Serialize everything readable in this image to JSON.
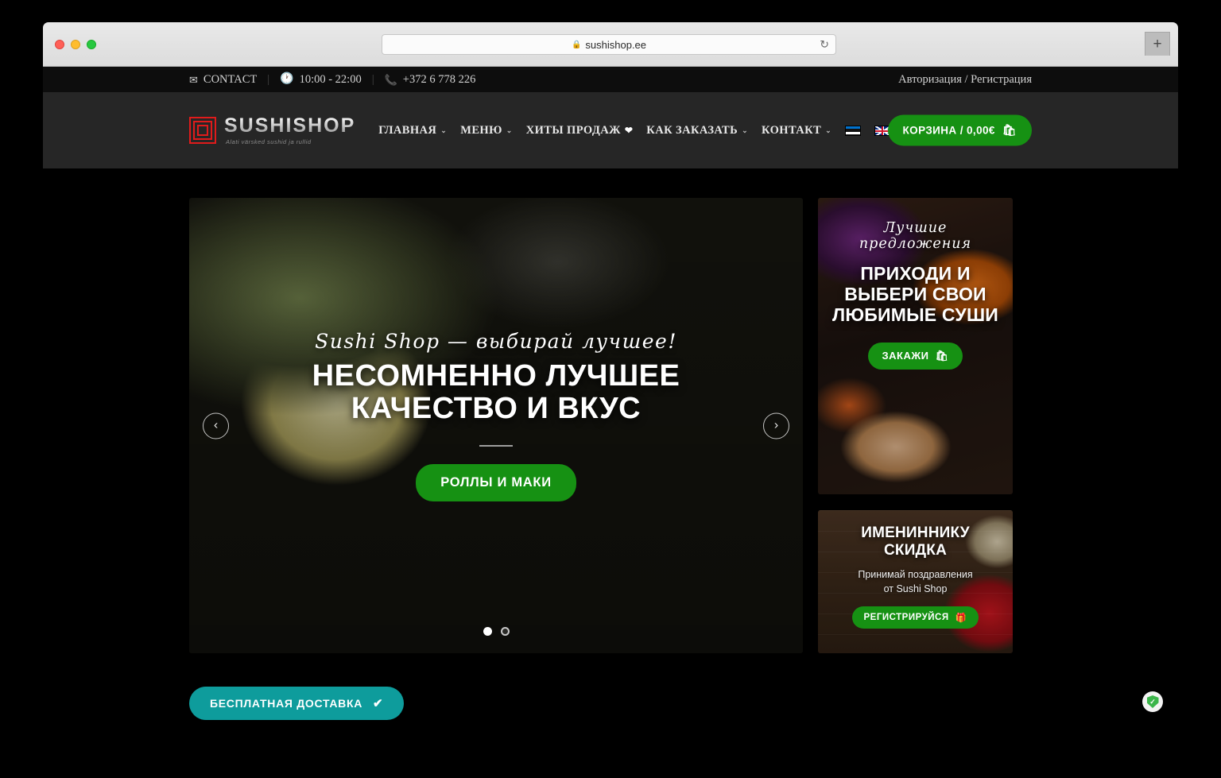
{
  "browser": {
    "url": "sushishop.ee",
    "lock_icon": "lock-icon",
    "reload_icon": "↻",
    "new_tab_label": "+"
  },
  "topbar": {
    "contact_label": "CONTACT",
    "hours": "10:00 - 22:00",
    "phone": "+372 6 778 226",
    "auth_label": "Авторизация / Регистрация",
    "separator": "|"
  },
  "header": {
    "logo_name": "SUSHI",
    "logo_name2": "SHOP",
    "logo_tagline": "Alati värsked sushid ja rullid",
    "nav": [
      {
        "label": "ГЛАВНАЯ",
        "caret": "⌄",
        "heart": ""
      },
      {
        "label": "МЕНЮ",
        "caret": "⌄",
        "heart": ""
      },
      {
        "label": "ХИТЫ ПРОДАЖ",
        "caret": "",
        "heart": "❤"
      },
      {
        "label": "КАК ЗАКАЗАТЬ",
        "caret": "⌄",
        "heart": ""
      },
      {
        "label": "КОНТАКТ",
        "caret": "⌄",
        "heart": ""
      }
    ],
    "cart_label": "КОРЗИНА / 0,00€",
    "cart_icon": "🛍",
    "accent_green": "#169113",
    "logo_red": "#e01b1b"
  },
  "hero": {
    "script_line": "Sushi Shop — выбирай лучшее!",
    "headline_line1": "НЕСОМНЕННО ЛУЧШЕЕ",
    "headline_line2": "КАЧЕСТВО И ВКУС",
    "cta_label": "РОЛЛЫ И МАКИ",
    "prev_icon": "‹",
    "next_icon": "›",
    "slide_count": 2,
    "active_slide": 1
  },
  "promo_top": {
    "script_line": "Лучшие предложения",
    "headline_line1": "ПРИХОДИ И",
    "headline_line2": "ВЫБЕРИ СВОИ",
    "headline_line3": "ЛЮБИМЫЕ СУШИ",
    "button_label": "ЗАКАЖИ",
    "button_icon": "🛍"
  },
  "promo_bottom": {
    "headline": "ИМЕНИННИКУ СКИДКА",
    "sub_line1": "Принимай поздравления",
    "sub_line2": "от Sushi Shop",
    "button_label": "РЕГИСТРИРУЙСЯ",
    "button_icon": "🎁"
  },
  "delivery": {
    "badge_label": "БЕСПЛАТНАЯ ДОСТАВКА",
    "check_icon": "✔",
    "badge_color": "#0e9c9c"
  },
  "trust": {
    "icon": "✓"
  }
}
